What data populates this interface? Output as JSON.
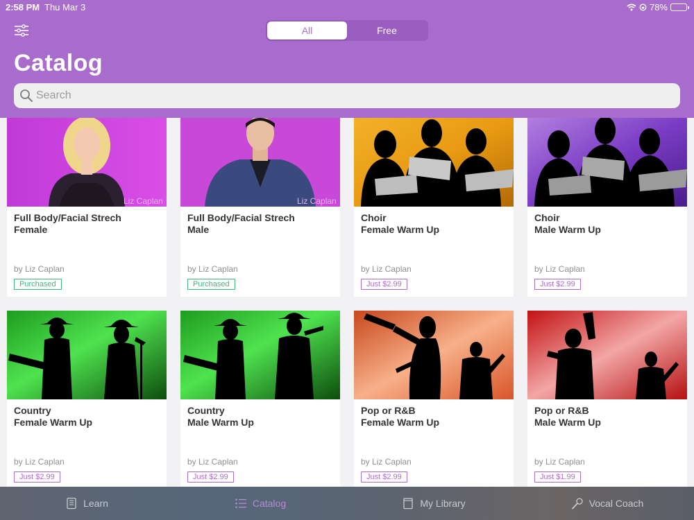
{
  "status": {
    "time": "2:58 PM",
    "date": "Thu Mar 3",
    "battery": "78%",
    "battery_level": 0.78
  },
  "header": {
    "segments": [
      "All",
      "Free"
    ],
    "active_segment": "All",
    "title": "Catalog",
    "search_placeholder": "Search"
  },
  "colors": {
    "accent": "#a86dcc",
    "purchased": "#3fb77c"
  },
  "cards": [
    {
      "title1": "Full Body/Facial Strech",
      "title2": "Female",
      "author": "by Liz Caplan",
      "badge": "Purchased",
      "badge_type": "purchased",
      "thumb": "liz-female",
      "watermark": "Liz Caplan"
    },
    {
      "title1": "Full Body/Facial Strech",
      "title2": "Male",
      "author": "by Liz Caplan",
      "badge": "Purchased",
      "badge_type": "purchased",
      "thumb": "liz-male",
      "watermark": "Liz Caplan"
    },
    {
      "title1": "Choir",
      "title2": "Female Warm Up",
      "author": "by Liz Caplan",
      "badge": "Just $2.99",
      "badge_type": "price",
      "thumb": "choir-orange"
    },
    {
      "title1": "Choir",
      "title2": "Male Warm Up",
      "author": "by Liz Caplan",
      "badge": "Just $2.99",
      "badge_type": "price",
      "thumb": "choir-purple"
    },
    {
      "title1": "Country",
      "title2": "Female Warm Up",
      "author": "by Liz Caplan",
      "badge": "Just $2.99",
      "badge_type": "price",
      "thumb": "country-female"
    },
    {
      "title1": "Country",
      "title2": "Male Warm Up",
      "author": "by Liz Caplan",
      "badge": "Just $2.99",
      "badge_type": "price",
      "thumb": "country-male"
    },
    {
      "title1": "Pop or R&B",
      "title2": "Female Warm Up",
      "author": "by Liz Caplan",
      "badge": "Just $2.99",
      "badge_type": "price",
      "thumb": "pop-female"
    },
    {
      "title1": "Pop or R&B",
      "title2": "Male Warm Up",
      "author": "by Liz Caplan",
      "badge": "Just $1.99",
      "badge_type": "price",
      "thumb": "pop-male"
    }
  ],
  "tabbar": {
    "items": [
      {
        "label": "Learn",
        "icon": "book-icon"
      },
      {
        "label": "Catalog",
        "icon": "list-icon",
        "active": true
      },
      {
        "label": "My Library",
        "icon": "library-icon"
      },
      {
        "label": "Vocal Coach",
        "icon": "microphone-icon"
      }
    ]
  }
}
